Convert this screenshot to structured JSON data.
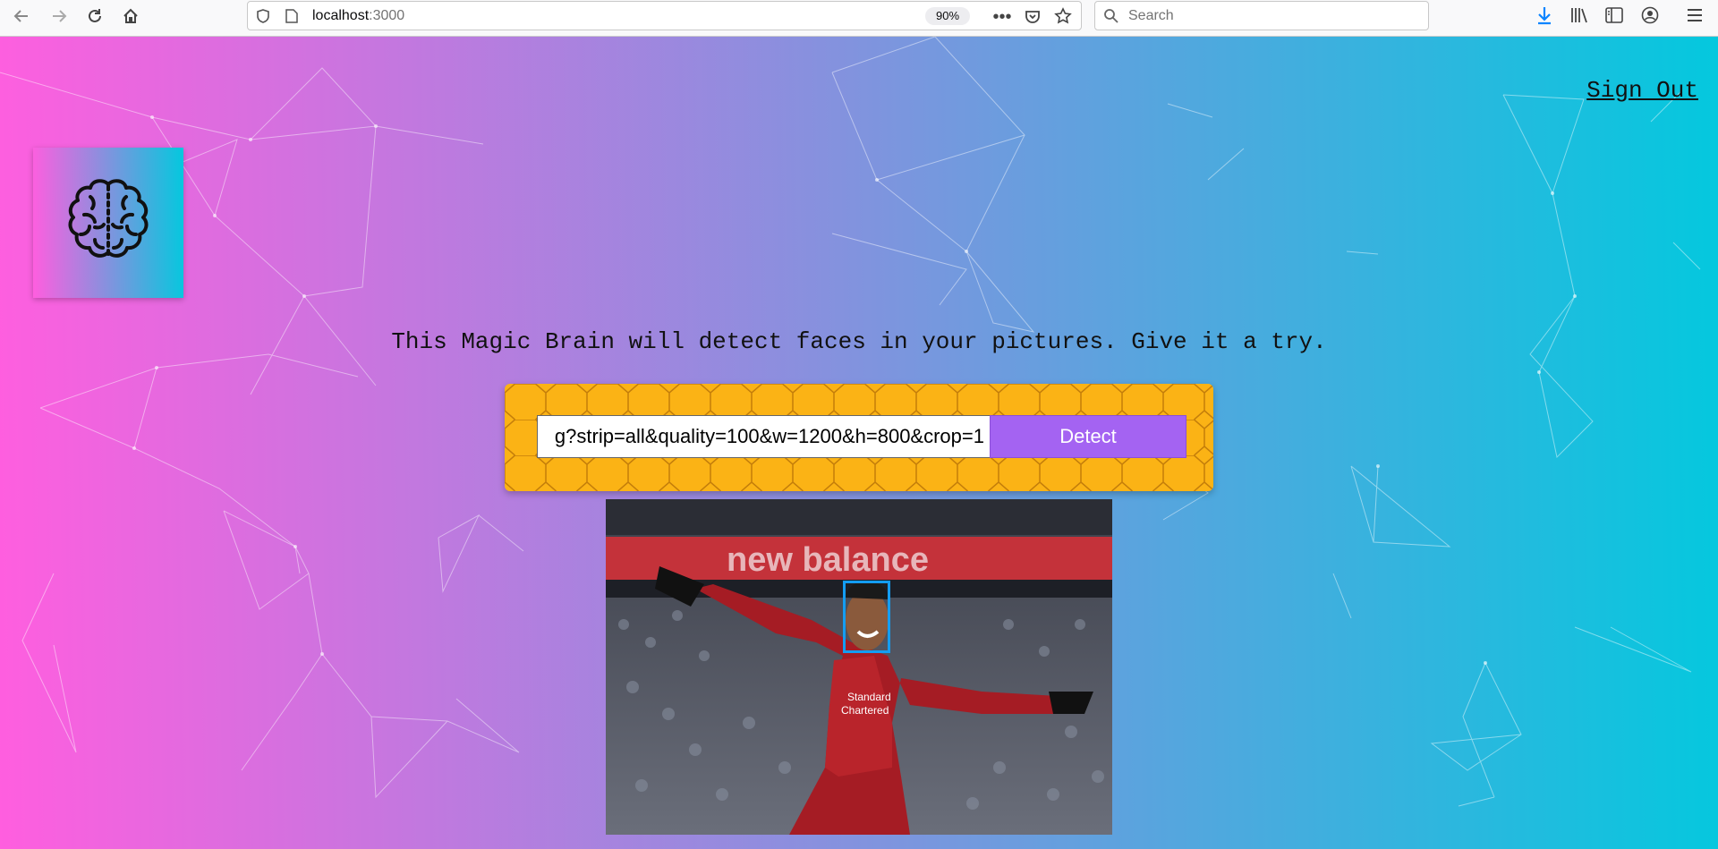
{
  "browser": {
    "url_host": "localhost",
    "url_port": ":3000",
    "zoom": "90%",
    "search_placeholder": "Search"
  },
  "header": {
    "signout_label": "Sign Out"
  },
  "main": {
    "tagline": "This Magic Brain will detect faces in your pictures. Give it a try.",
    "image_url_value": "g?strip=all&quality=100&w=1200&h=800&crop=1",
    "detect_label": "Detect"
  },
  "photo": {
    "banner_text": "new balance",
    "shirt_text_1": "Standard",
    "shirt_text_2": "Chartered"
  },
  "colors": {
    "gradient_start": "#ff5edf",
    "gradient_end": "#04c8de",
    "detect_button": "#a463f2",
    "form_pattern": "#fbb315",
    "face_box": "#149df2"
  }
}
